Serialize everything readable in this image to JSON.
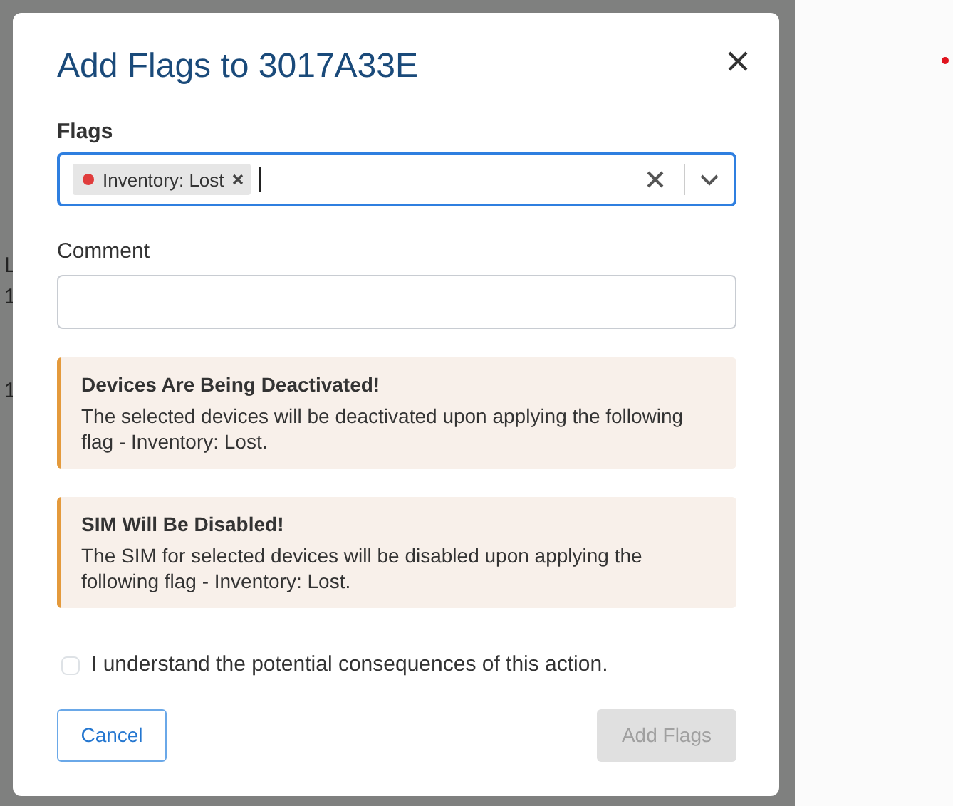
{
  "background": {
    "texts": [
      "L",
      "1",
      "1"
    ]
  },
  "dialog": {
    "title": "Add Flags to 3017A33E",
    "flags_field": {
      "label": "Flags",
      "focused": true,
      "chips": [
        {
          "label": "Inventory: Lost",
          "color": "#e03c3c"
        }
      ]
    },
    "comment_field": {
      "label": "Comment"
    },
    "alerts": [
      {
        "kind": "warning",
        "title": "Devices Are Being Deactivated!",
        "text": "The selected devices will be deactivated upon applying the following flag - Inventory: Lost."
      },
      {
        "kind": "warning",
        "title": "SIM Will Be Disabled!",
        "text": "The SIM for selected devices will be disabled upon applying the following flag - Inventory: Lost."
      }
    ],
    "confirm": {
      "label": "I understand the potential consequences of this action.",
      "checked": false
    },
    "buttons": [
      {
        "label": "Cancel",
        "kind": "outline",
        "disabled": false
      },
      {
        "label": "Add Flags",
        "kind": "primary",
        "disabled": true
      }
    ]
  },
  "side_marker": {
    "color": "#e0141e"
  }
}
